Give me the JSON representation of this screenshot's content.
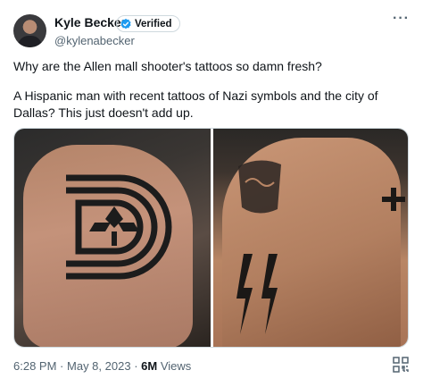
{
  "author": {
    "name": "Kyle Becker",
    "handle": "@kylenabecker",
    "verified_label": "Verified"
  },
  "tweet": {
    "line1": "Why are the Allen mall shooter's tattoos so damn fresh?",
    "line2": "A Hispanic man with recent tattoos of Nazi symbols and the city of Dallas? This just doesn't add up."
  },
  "meta": {
    "time": "6:28 PM",
    "sep1": "·",
    "date": "May 8, 2023",
    "sep2": "·",
    "views_count": "6M",
    "views_label": "Views"
  },
  "colors": {
    "accent": "#1d9bf0",
    "text": "#0f1419",
    "muted": "#536471"
  },
  "icons": {
    "more": "more-icon",
    "verified": "verified-badge-icon",
    "qr": "qr-code-icon"
  }
}
